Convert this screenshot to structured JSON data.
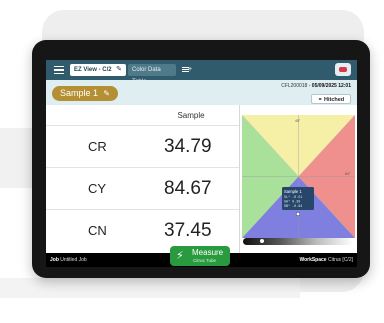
{
  "header": {
    "active_tab": "EZ View - C/2",
    "second_tab": "Color Data Table",
    "edit_icon": "edit-icon",
    "add_tab_icon": "add-list-icon",
    "menu_icon": "hamburger-icon",
    "device_icon": "device-status-icon"
  },
  "subbar": {
    "sample_name": "Sample 1",
    "device_id": "CFL200018",
    "datetime": "05/09/2025 12:01",
    "hitched_label": "Hitched"
  },
  "table": {
    "column_header": "Sample",
    "rows": [
      {
        "label": "CR",
        "value": "34.79"
      },
      {
        "label": "CY",
        "value": "84.67"
      },
      {
        "label": "CN",
        "value": "37.45"
      }
    ]
  },
  "chart": {
    "label_top": "45°",
    "label_right": "84°",
    "popup": {
      "title": "Sample 1",
      "line1": "SL*  -0.51",
      "line2": "SA*  0.39",
      "line3": "SB*  -0.64"
    },
    "slider_level": 0.16,
    "colors": {
      "top": "#f5f0a6",
      "right": "#ef8f8e",
      "bottom": "#7f7fe0",
      "left": "#a9e09a"
    }
  },
  "footer": {
    "job_label": "Job",
    "job_value": "Untitled Job",
    "measure_label": "Measure",
    "measure_sub": "Citrus Tube",
    "workspace_label": "WorkSpace",
    "workspace_value": "Citrus [C/2]"
  },
  "colors": {
    "topbar": "#2f5b6c",
    "accent": "#b48f33",
    "measure": "#2a9a3e"
  }
}
